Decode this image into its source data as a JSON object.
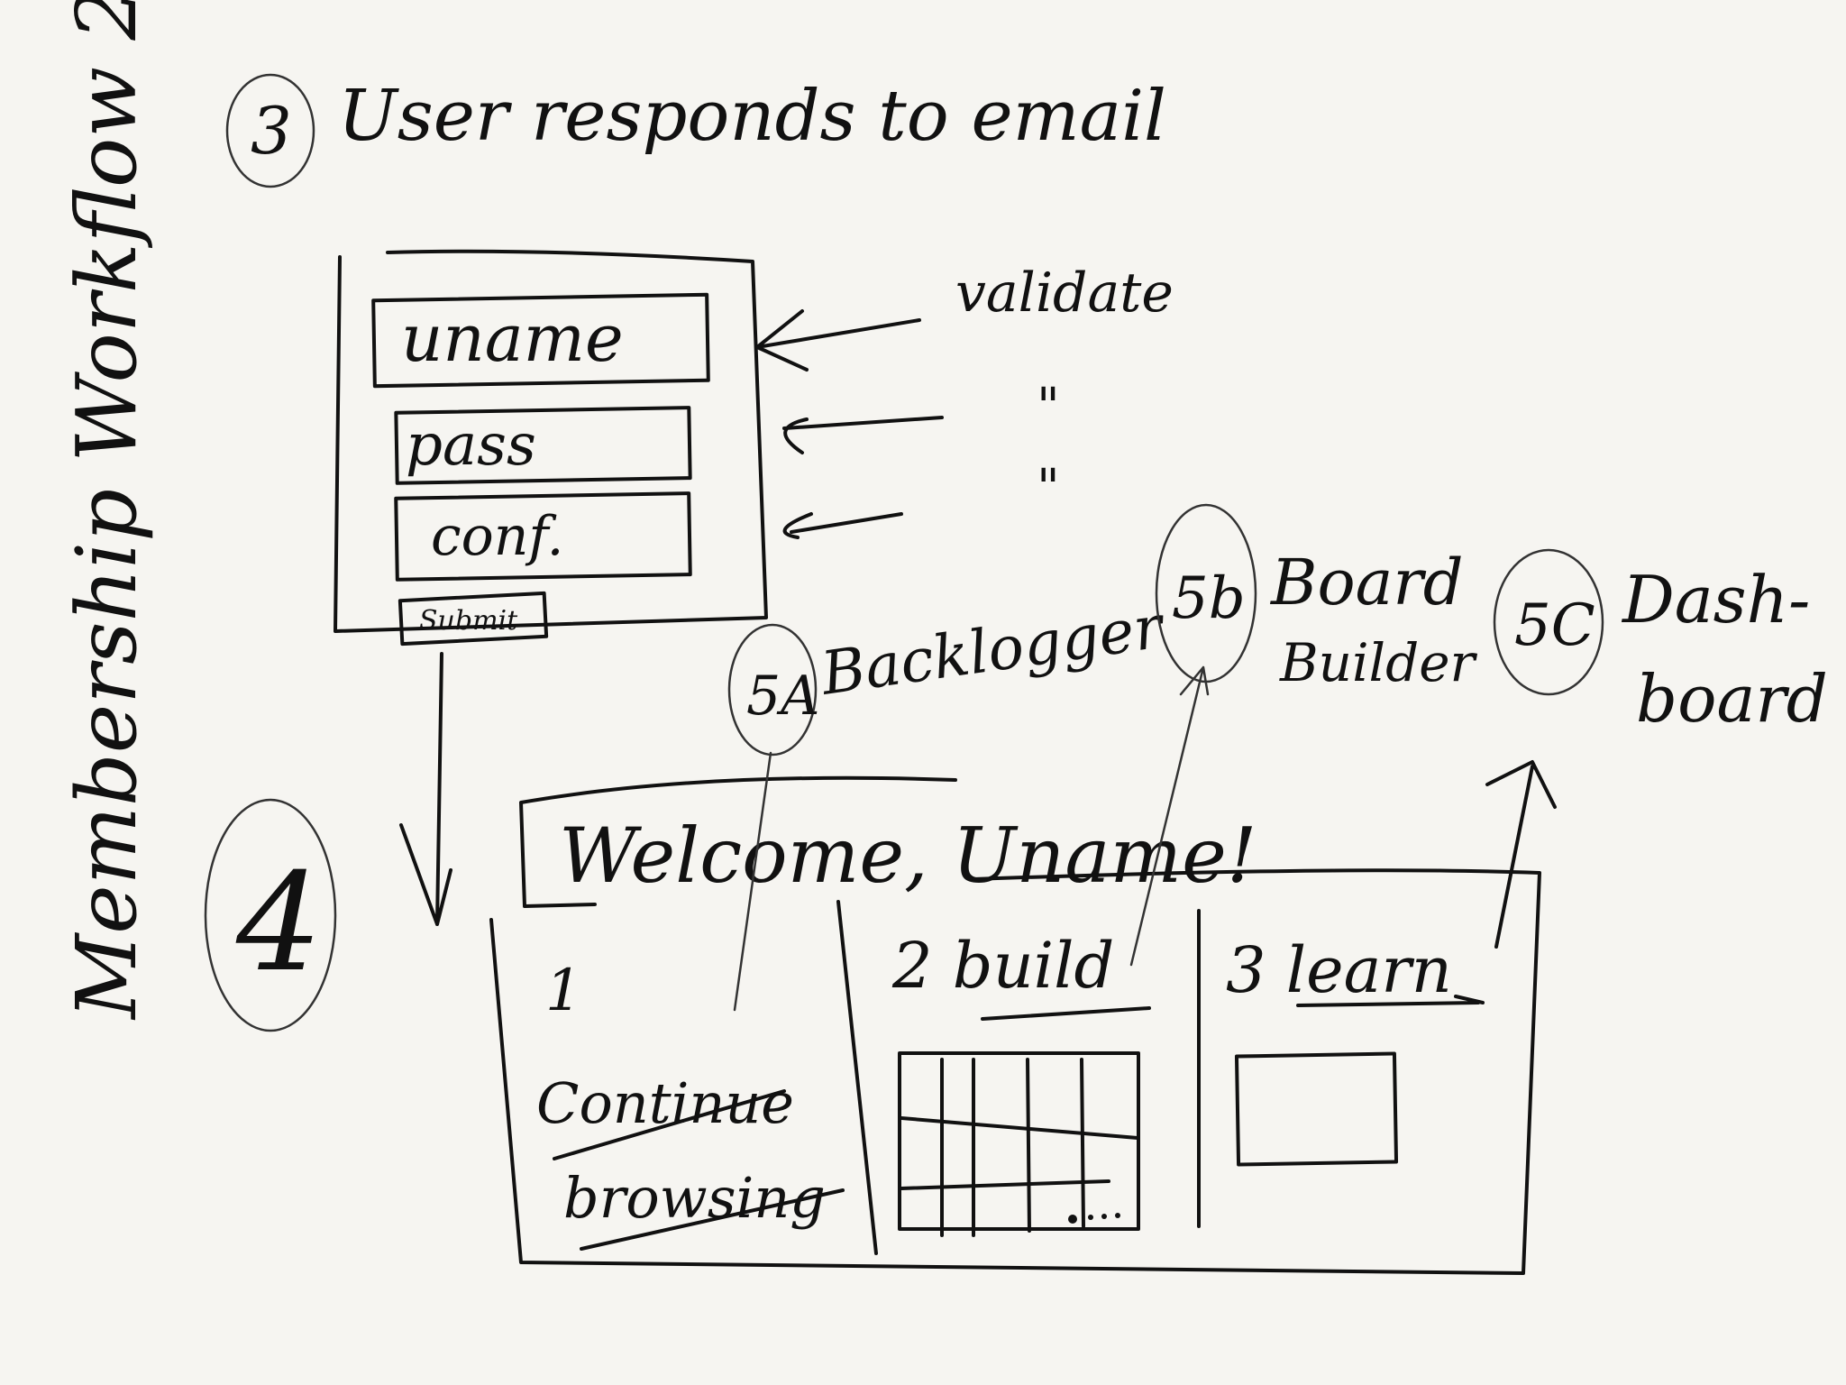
{
  "title": "Membership Workflow 2",
  "step3": {
    "number": "3",
    "heading": "User responds to email"
  },
  "form": {
    "username_field": "uname",
    "password_field": "pass",
    "confirm_field": "conf.",
    "submit_button": "Submit"
  },
  "annotations": {
    "validate": "validate",
    "ditto_1": "\"",
    "ditto_2": "\""
  },
  "step4": {
    "number": "4",
    "welcome": "Welcome, Uname!",
    "columns": [
      {
        "heading": "1",
        "text_1": "Continue",
        "text_2": "browsing"
      },
      {
        "heading": "2 build"
      },
      {
        "heading": "3 learn"
      }
    ]
  },
  "step5a": {
    "number": "5A",
    "label": "Backlogger"
  },
  "step5b": {
    "number": "5b",
    "label_1": "Board",
    "label_2": "Builder"
  },
  "step5c": {
    "number": "5C",
    "label_1": "Dash-",
    "label_2": "board"
  }
}
